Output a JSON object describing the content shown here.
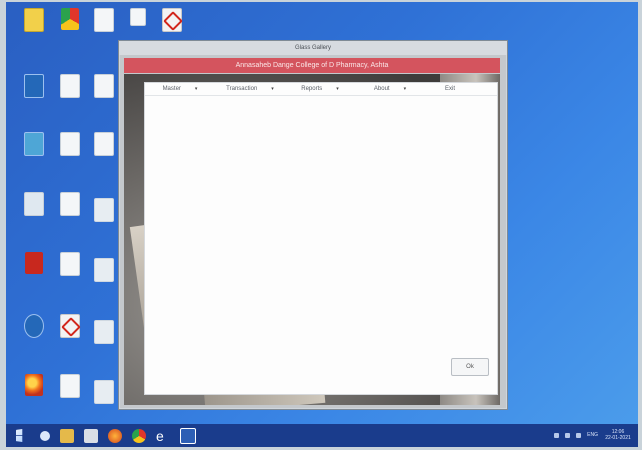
{
  "desktop": {
    "icons": [
      {
        "name": "file-icon",
        "label": "",
        "glyph": "g-file"
      },
      {
        "name": "chrome-icon",
        "label": "Google Chrome",
        "glyph": "g-chrome"
      },
      {
        "name": "file-icon",
        "label": "",
        "glyph": "g-file"
      },
      {
        "name": "file-icon",
        "label": "",
        "glyph": "g-file"
      },
      {
        "name": "pdf-icon",
        "label": "",
        "glyph": "g-pdf"
      }
    ]
  },
  "window": {
    "title": "Glass Gallery",
    "banner": "Annasaheb Dange College of D Pharmacy, Ashta",
    "menus": [
      {
        "label": "Master"
      },
      {
        "label": "Transaction"
      },
      {
        "label": "Reports"
      },
      {
        "label": "About"
      }
    ],
    "exit_label": "Exit",
    "ok_label": "Ok"
  },
  "taskbar": {
    "lang": "ENG",
    "time": "12:06",
    "date": "22-01-2021"
  },
  "colors": {
    "banner": "#d4545e",
    "desktop": "#2f71d6",
    "taskbar": "#1a3c8c"
  }
}
